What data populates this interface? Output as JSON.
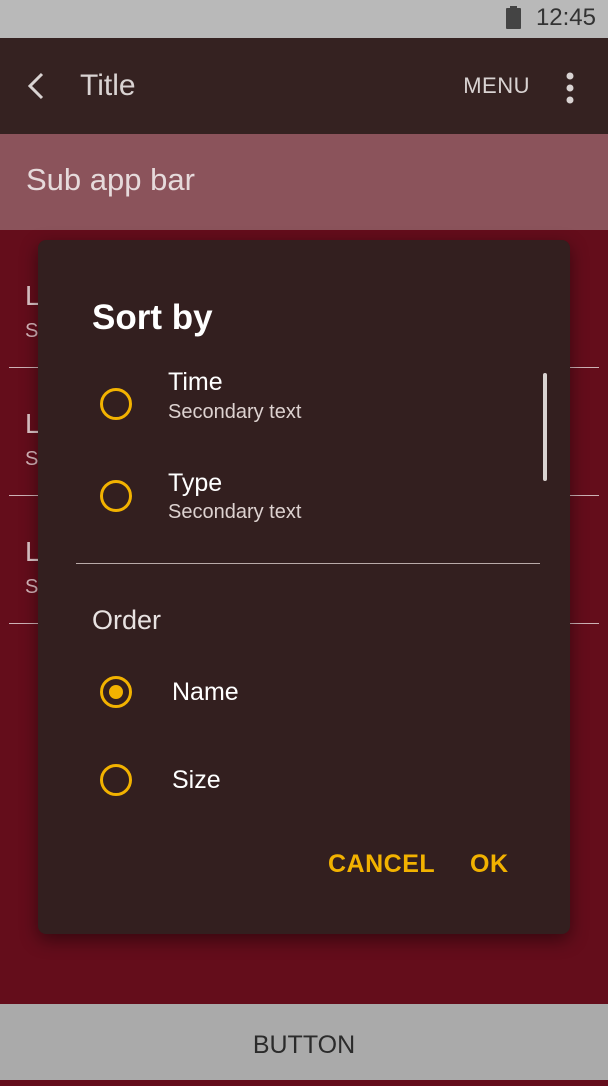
{
  "status_bar": {
    "time": "12:45"
  },
  "app_bar": {
    "title": "Title",
    "menu_label": "MENU"
  },
  "sub_app_bar": {
    "title": "Sub app bar"
  },
  "list": {
    "items": [
      {
        "primary": "L",
        "secondary": "S"
      },
      {
        "primary": "L",
        "secondary": "S"
      },
      {
        "primary": "L",
        "secondary": "S"
      }
    ]
  },
  "dialog": {
    "title": "Sort by",
    "sort_options": [
      {
        "label": "Time",
        "secondary": "Secondary text",
        "checked": false
      },
      {
        "label": "Type",
        "secondary": "Secondary text",
        "checked": false
      }
    ],
    "order_title": "Order",
    "order_options": [
      {
        "label": "Name",
        "checked": true
      },
      {
        "label": "Size",
        "checked": false
      }
    ],
    "cancel_label": "CANCEL",
    "ok_label": "OK"
  },
  "bottom_bar": {
    "button_label": "BUTTON"
  },
  "colors": {
    "accent": "#f2b200",
    "app_bar": "#352221",
    "sub_app_bar": "#8b535b",
    "background": "#640d1b",
    "dialog": "#331f1f",
    "bottom_bar": "#aaaaaa"
  }
}
